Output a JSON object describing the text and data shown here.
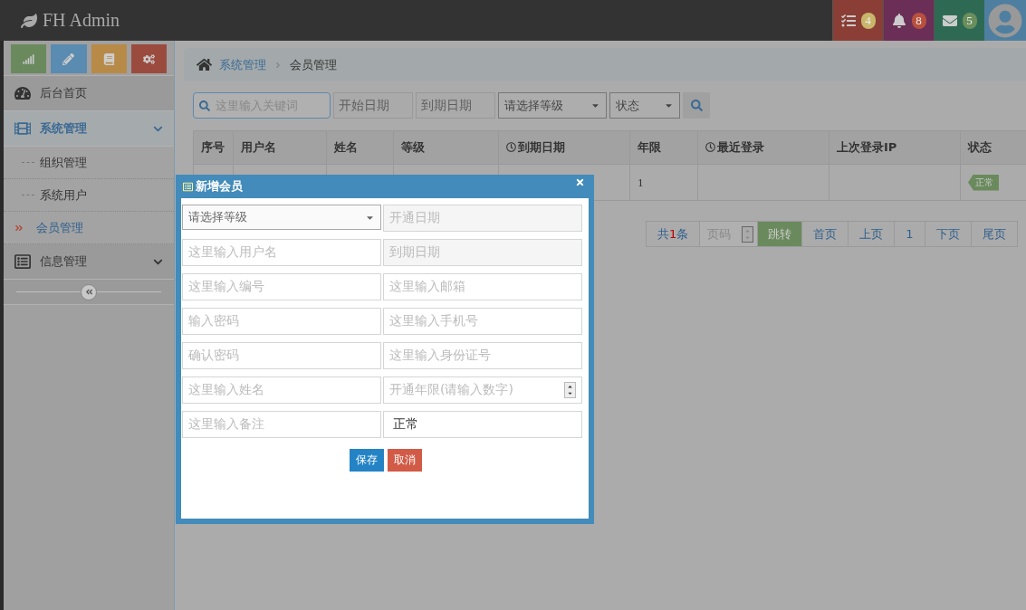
{
  "header": {
    "brand": "FH Admin",
    "badges": [
      {
        "kind": "tasks",
        "count": "4",
        "color": "#c8b76a"
      },
      {
        "kind": "bell",
        "count": "8",
        "color": "#b8503e"
      },
      {
        "kind": "mail",
        "count": "5",
        "color": "#6a8f5d"
      }
    ]
  },
  "sidebar": {
    "shortcuts": [
      {
        "kind": "chart"
      },
      {
        "kind": "pencil"
      },
      {
        "kind": "book"
      },
      {
        "kind": "cogs"
      }
    ],
    "items": [
      {
        "label": "后台首页",
        "kind": "dashboard",
        "expanded": false
      },
      {
        "label": "系统管理",
        "kind": "film",
        "expanded": true,
        "children": [
          {
            "label": "组织管理",
            "selected": false
          },
          {
            "label": "系统用户",
            "selected": false
          },
          {
            "label": "会员管理",
            "selected": true
          }
        ]
      },
      {
        "label": "信息管理",
        "kind": "list",
        "expanded": false
      }
    ]
  },
  "breadcrumb": {
    "parent": "系统管理",
    "current": "会员管理"
  },
  "filters": {
    "keyword_placeholder": "这里输入关键词",
    "start_placeholder": "开始日期",
    "end_placeholder": "到期日期",
    "level_select": "请选择等级",
    "status_select": "状态"
  },
  "table": {
    "columns": [
      {
        "label": "序号",
        "clock": false
      },
      {
        "label": "用户名",
        "clock": false
      },
      {
        "label": "姓名",
        "clock": false
      },
      {
        "label": "等级",
        "clock": false
      },
      {
        "label": "到期日期",
        "clock": true
      },
      {
        "label": "年限",
        "clock": false
      },
      {
        "label": "最近登录",
        "clock": true
      },
      {
        "label": "上次登录IP",
        "clock": false
      },
      {
        "label": "状态",
        "clock": false
      }
    ],
    "rows": [
      {
        "cells": [
          "",
          "",
          "",
          "",
          "",
          "1",
          "",
          "",
          ""
        ],
        "status": "正常"
      }
    ]
  },
  "pagination": {
    "total_prefix": "共",
    "total_count": "1",
    "total_suffix": "条",
    "page_placeholder": "页码",
    "go": "跳转",
    "links": [
      "首页",
      "上页",
      "1",
      "下页",
      "尾页"
    ]
  },
  "modal": {
    "title": "新增会员",
    "fields": [
      {
        "kind": "select",
        "text": "请选择等级"
      },
      {
        "kind": "date",
        "text": "开通日期"
      },
      {
        "kind": "input",
        "text": "这里输入用户名"
      },
      {
        "kind": "date",
        "text": "到期日期"
      },
      {
        "kind": "input",
        "text": "这里输入编号"
      },
      {
        "kind": "input",
        "text": "这里输入邮箱"
      },
      {
        "kind": "input",
        "text": "输入密码"
      },
      {
        "kind": "input",
        "text": "这里输入手机号"
      },
      {
        "kind": "input",
        "text": "确认密码"
      },
      {
        "kind": "input",
        "text": "这里输入身份证号"
      },
      {
        "kind": "input",
        "text": "这里输入姓名"
      },
      {
        "kind": "number",
        "text": "开通年限(请输入数字)"
      },
      {
        "kind": "input",
        "text": "这里输入备注"
      },
      {
        "kind": "value",
        "text": "正常"
      }
    ],
    "save": "保存",
    "cancel": "取消"
  }
}
